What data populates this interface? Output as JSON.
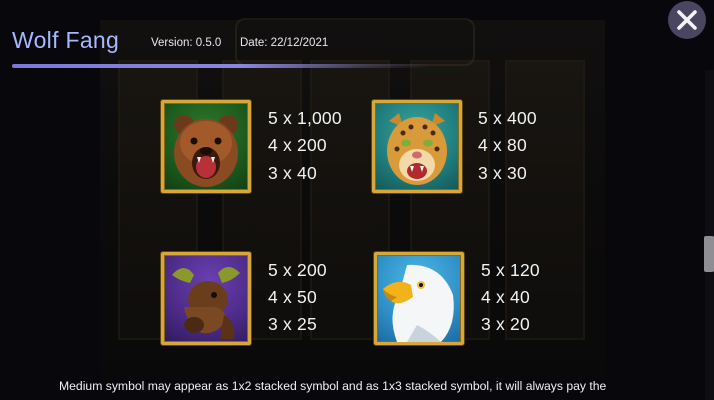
{
  "header": {
    "title": "Wolf Fang",
    "version": "Version: 0.5.0",
    "date": "Date: 22/12/2021"
  },
  "close_icon": "close-icon",
  "colors": {
    "title": "#a8b8ff",
    "accent_line": "#7c78d9",
    "frame_gold": "#d7a838",
    "background": "#07070c"
  },
  "symbols": [
    {
      "name": "bear",
      "icon": "bear-icon",
      "payouts": [
        "5 x 1,000",
        "4 x 200",
        "3 x 40"
      ]
    },
    {
      "name": "leopard",
      "icon": "leopard-icon",
      "payouts": [
        "5 x 400",
        "4 x 80",
        "3 x 30"
      ]
    },
    {
      "name": "moose",
      "icon": "moose-icon",
      "payouts": [
        "5 x 200",
        "4 x 50",
        "3 x 25"
      ]
    },
    {
      "name": "eagle",
      "icon": "eagle-icon",
      "payouts": [
        "5 x 120",
        "4 x 40",
        "3 x 20"
      ]
    }
  ],
  "footer": {
    "text": "Medium symbol may appear as 1x2 stacked symbol and as 1x3 stacked symbol, it will always pay the"
  }
}
